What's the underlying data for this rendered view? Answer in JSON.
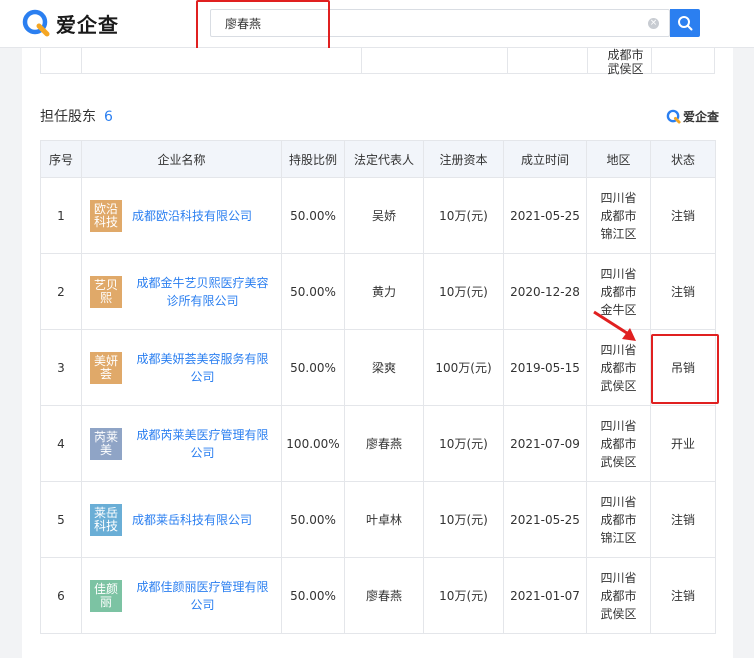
{
  "header": {
    "logo_text": "爱企查",
    "search_value": "廖春燕",
    "clear_glyph": "×"
  },
  "prev_table": {
    "region_lines": [
      "成都市",
      "武侯区"
    ]
  },
  "section": {
    "title": "担任股东",
    "count": "6",
    "brand": "爱企查"
  },
  "table": {
    "columns": [
      "序号",
      "企业名称",
      "持股比例",
      "法定代表人",
      "注册资本",
      "成立时间",
      "地区",
      "状态"
    ],
    "rows": [
      {
        "index": "1",
        "logo": "欧沿科技",
        "logo_color": "#e0a969",
        "company": "成都欧沿科技有限公司",
        "ratio": "50.00%",
        "rep": "吴娇",
        "capital": "10万(元)",
        "date": "2021-05-25",
        "region": [
          "四川省",
          "成都市",
          "锦江区"
        ],
        "status": "注销",
        "status_color": "red"
      },
      {
        "index": "2",
        "logo": "艺贝熙",
        "logo_color": "#e0a969",
        "company": "成都金牛艺贝熙医疗美容诊所有限公司",
        "ratio": "50.00%",
        "rep": "黄力",
        "capital": "10万(元)",
        "date": "2020-12-28",
        "region": [
          "四川省",
          "成都市",
          "金牛区"
        ],
        "status": "注销",
        "status_color": "red"
      },
      {
        "index": "3",
        "logo": "美妍荟",
        "logo_color": "#e0a969",
        "company": "成都美妍荟美容服务有限公司",
        "ratio": "50.00%",
        "rep": "梁爽",
        "capital": "100万(元)",
        "date": "2019-05-15",
        "region": [
          "四川省",
          "成都市",
          "武侯区"
        ],
        "status": "吊销",
        "status_color": "red"
      },
      {
        "index": "4",
        "logo": "芮莱美",
        "logo_color": "#8fa4c6",
        "company": "成都芮莱美医疗管理有限公司",
        "ratio": "100.00%",
        "rep": "廖春燕",
        "capital": "10万(元)",
        "date": "2021-07-09",
        "region": [
          "四川省",
          "成都市",
          "武侯区"
        ],
        "status": "开业",
        "status_color": "green"
      },
      {
        "index": "5",
        "logo": "莱岳科技",
        "logo_color": "#6aaed6",
        "company": "成都莱岳科技有限公司",
        "ratio": "50.00%",
        "rep": "叶卓林",
        "capital": "10万(元)",
        "date": "2021-05-25",
        "region": [
          "四川省",
          "成都市",
          "锦江区"
        ],
        "status": "注销",
        "status_color": "red"
      },
      {
        "index": "6",
        "logo": "佳颜丽",
        "logo_color": "#7cc3a3",
        "company": "成都佳颜丽医疗管理有限公司",
        "ratio": "50.00%",
        "rep": "廖春燕",
        "capital": "10万(元)",
        "date": "2021-01-07",
        "region": [
          "四川省",
          "成都市",
          "武侯区"
        ],
        "status": "注销",
        "status_color": "red"
      }
    ]
  },
  "colors": {
    "accent": "#2b7ff0",
    "status_red": "#e4543d",
    "status_green": "#3c9b3c",
    "annotation_red": "#e02020"
  }
}
